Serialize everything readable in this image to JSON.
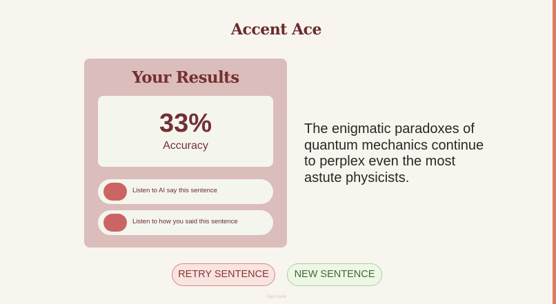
{
  "app": {
    "title": "Accent Ace"
  },
  "results": {
    "title": "Your Results",
    "score": "33%",
    "score_label": "Accuracy",
    "listen_ai_label": "Listen to AI say this sentence",
    "listen_user_label": "Listen to how you said this sentence"
  },
  "sentence": {
    "text": "The enigmatic paradoxes of quantum mechanics continue to perplex even the most astute physicists."
  },
  "actions": {
    "retry_label": "RETRY SENTENCE",
    "new_label": "NEW SENTENCE"
  },
  "footer": {
    "note": "Tapy made"
  },
  "colors": {
    "accent_edge": "#e07a63",
    "card_bg": "#dbbdbb",
    "title_brown": "#6b2a2c",
    "audio_pill": "#cb6563",
    "retry_border": "#d98883",
    "new_border": "#a6d39a"
  }
}
